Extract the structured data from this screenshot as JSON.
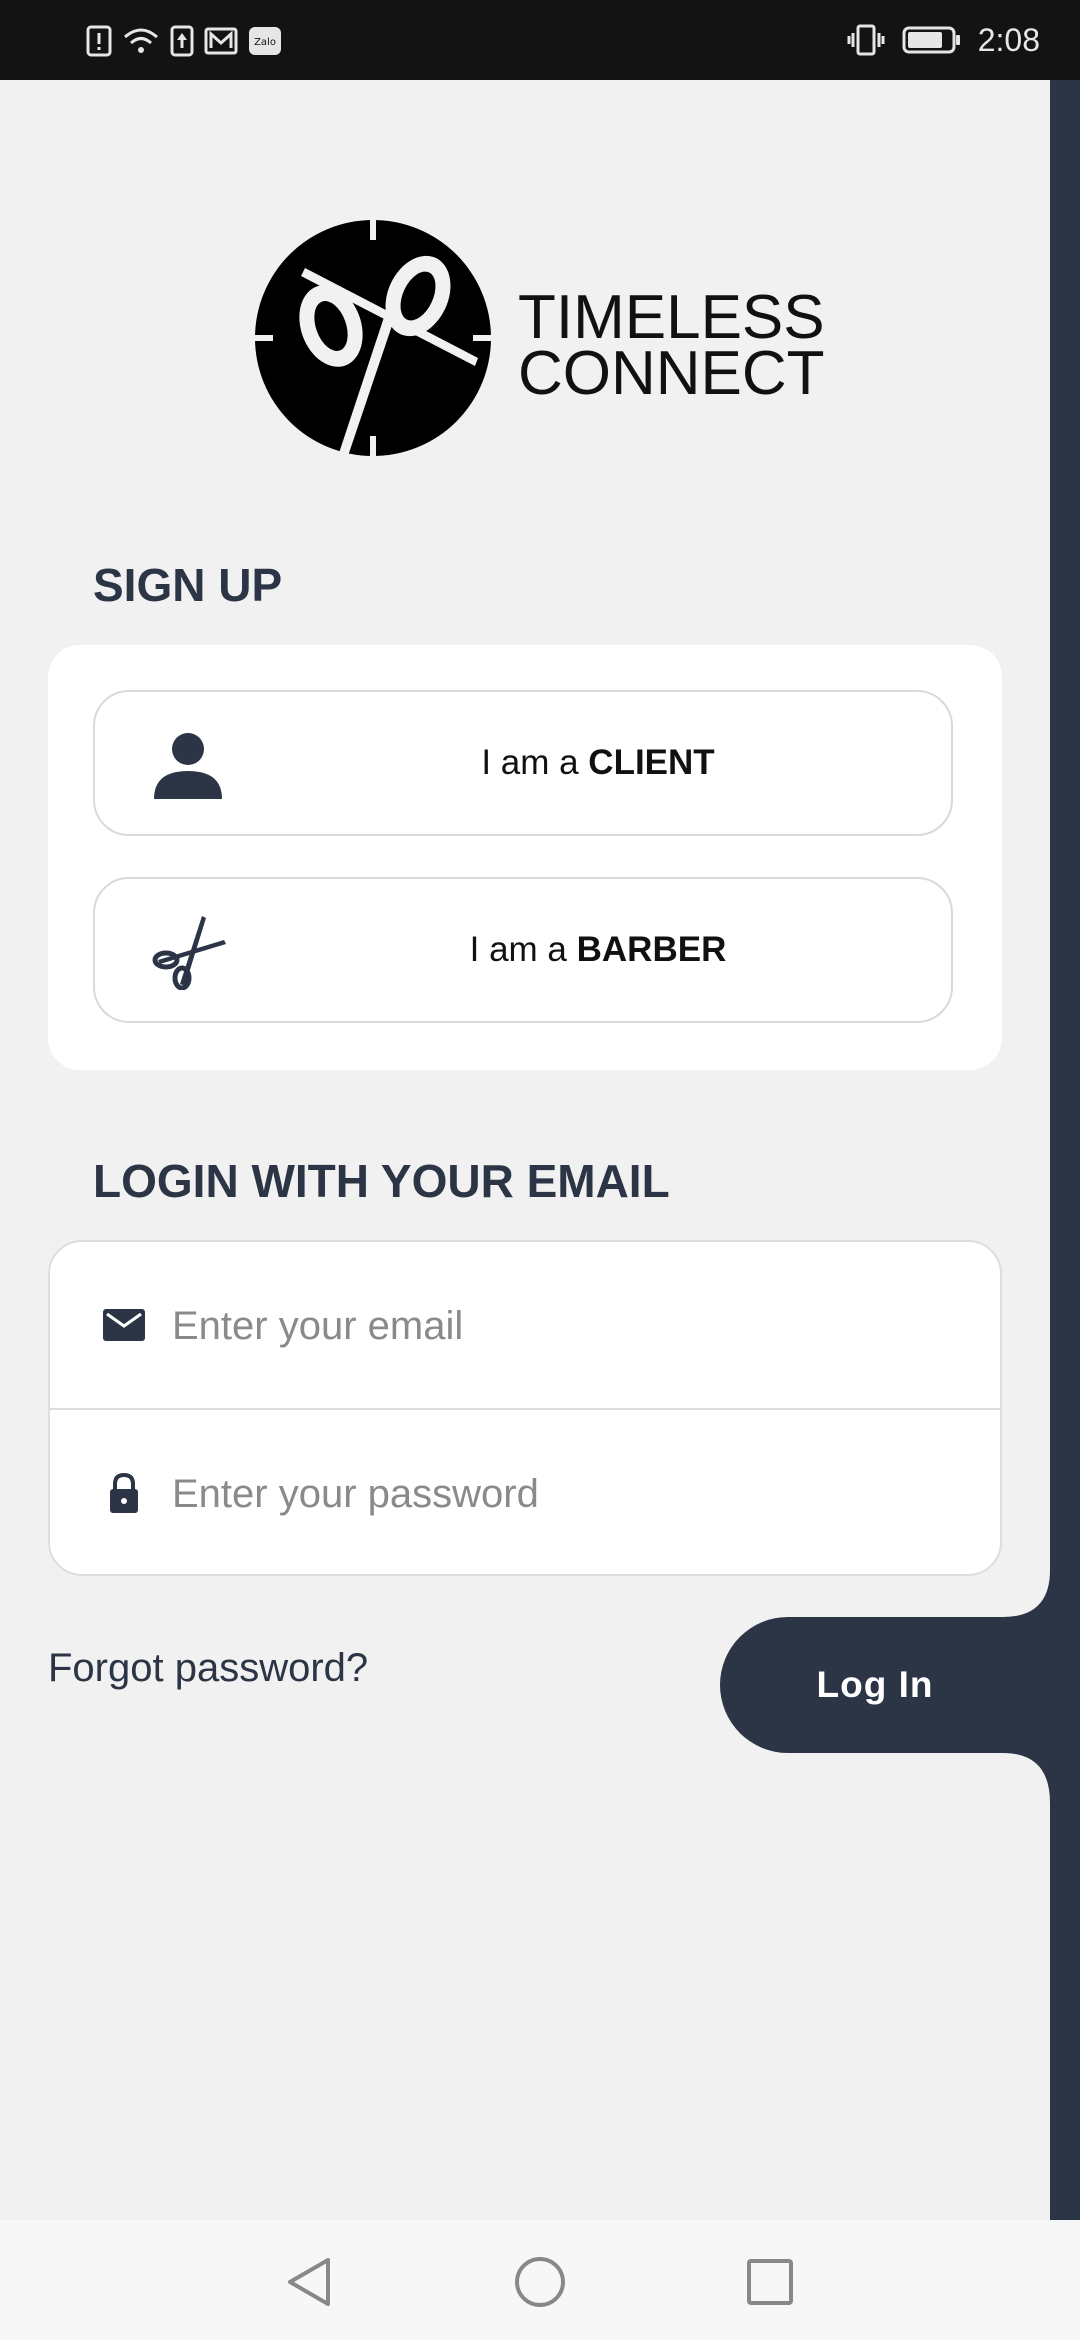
{
  "status_bar": {
    "time": "2:08",
    "left_icons": [
      "alert-icon",
      "wifi-icon",
      "upload-icon",
      "mail-icon",
      "zalo-icon"
    ],
    "right_icons": [
      "vibrate-icon",
      "battery-icon"
    ]
  },
  "logo": {
    "line1": "TIMELESS",
    "line2": "CONNECT"
  },
  "signup": {
    "heading": "SIGN UP",
    "client": {
      "prefix": "I am a ",
      "bold": "CLIENT"
    },
    "barber": {
      "prefix": "I am a ",
      "bold": "BARBER"
    }
  },
  "login": {
    "heading": "LOGIN WITH YOUR EMAIL",
    "email_placeholder": "Enter your email",
    "password_placeholder": "Enter your password",
    "forgot": "Forgot password?",
    "button": "Log In"
  },
  "colors": {
    "primary": "#2b3546",
    "background": "#f1f1f1",
    "card": "#ffffff",
    "status_bar": "#131313"
  }
}
